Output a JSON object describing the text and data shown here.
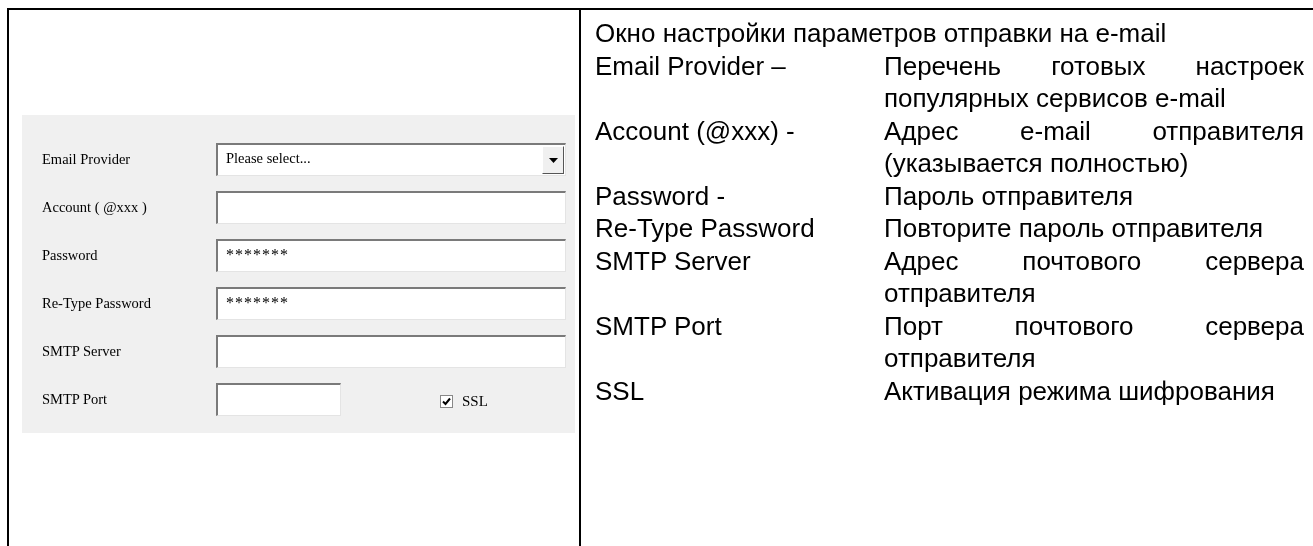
{
  "dialog": {
    "fields": [
      {
        "kind": "select",
        "label": "Email Provider",
        "value": "Please select..."
      },
      {
        "kind": "text",
        "label": "Account ( @xxx )"
      },
      {
        "kind": "password",
        "label": "Password",
        "value": "*******"
      },
      {
        "kind": "password",
        "label": "Re-Type Password",
        "value": "*******"
      },
      {
        "kind": "text",
        "label": "SMTP Server"
      },
      {
        "kind": "port",
        "label": "SMTP Port"
      }
    ],
    "ssl": {
      "label": "SSL",
      "checked": true
    }
  },
  "description": {
    "title": "Окно настройки параметров отправки на e-mail",
    "items": [
      {
        "term": "Email Provider –",
        "text": "Перечень готовых настроек популярных сервисов e-mail"
      },
      {
        "term": "Account (@xxx) -",
        "text": "Адрес e-mail отправителя (указывается полностью)"
      },
      {
        "term": "Password -",
        "text": "Пароль отправителя"
      },
      {
        "term": "Re-Type Password",
        "text": "Повторите пароль отправителя"
      },
      {
        "term": "SMTP Server",
        "text": "Адрес почтового сервера отправителя"
      },
      {
        "term": "SMTP Port",
        "text": "Порт почтового сервера отправителя"
      },
      {
        "term": "SSL",
        "text": "Активация режима шифрования"
      }
    ]
  }
}
